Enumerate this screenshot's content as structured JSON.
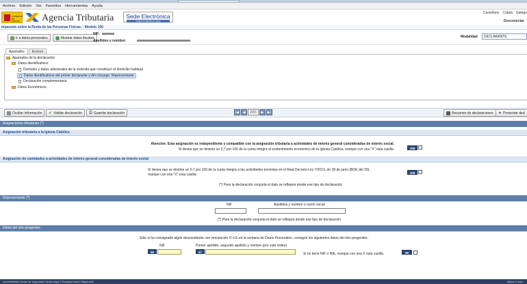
{
  "menu": [
    "Archivo",
    "Edición",
    "Ver",
    "Favoritos",
    "Herramientas",
    "Ayuda"
  ],
  "header": {
    "brand": "Agencia Tributaria",
    "sede_title": "Sede Electrónica",
    "sede_sub": "Todos los trámites en línea",
    "languages": [
      "Castellano",
      "Català",
      "Galego"
    ],
    "logout": "Desconectar",
    "spain_logo_text": "GOBIERNO DE ESPAÑA"
  },
  "model_title": "Impuesto sobre la Renta de las Personas Físicas. - Modelo 100",
  "personal": {
    "btn_personal": "Ir a datos personales",
    "btn_fiscal": "Mostrar datos fiscales",
    "nif_label": "NIF:",
    "name_label": "Apellidos y nombre:",
    "modalidad_label": "Modalidad",
    "modalidad_value": "DECLARANTE"
  },
  "tabs": [
    "Apartados",
    "Errores"
  ],
  "tree": [
    "Apartados de la declaración",
    "Datos identificativos",
    "Domicilio y datos adicionales de la vivienda que constituyó el domicilio habitual",
    "Datos identificativos del primer declarante y del cónyuge. Representante",
    "Declaración complementaria",
    "Datos Económicos"
  ],
  "toolbar": {
    "btn_hide": "Ocultar información",
    "btn_validate": "Validar declaración",
    "btn_save": "Guardar declaración",
    "page": "2/33",
    "btn_summary": "Resumen de declaraciones",
    "btn_present": "Presentar decl"
  },
  "asignaciones": {
    "title": "Asignaciones tributarias (*)",
    "sub1": "Asignación tributaria a la Iglesia Católica",
    "text1a": "Atención: Esta asignación es independiente y compatible con la asignación tributaria a actividades de interés general consideradas de interés social.",
    "text1b": "Si desea que se destine un 0,7 por 100 de la cuota íntegra al sostenimiento económico de la Iglesia Católica, marque con una \"X\" esta casilla:",
    "box1": "105",
    "sub2": "Asignación de cantidades a actividades de interés general consideradas de interés social",
    "text2a": "Si desea que se destine un 0,7 por 100 de la cuota íntegra a las actividades previstas en el Real Decreto-Ley 7/2013, de 28 de junio (BOE del 29),",
    "text2b": "marque con una \"X\" esta casilla:",
    "box2": "106",
    "note": "(*) Para la declaración conjunta el dato se reflejará desde ese tipo de declaración"
  },
  "representante": {
    "title": "Representante (*)",
    "nif": "NIF",
    "name": "Apellidos y nombre o razón social",
    "note": "(*) Para la declaración conjunta el dato se reflejará desde ese tipo de declaración"
  },
  "progenitor": {
    "title": "Datos del otro progenitor",
    "text": "Sólo si ha consignado algún descendiente con vinculación O ó E en la ventana de Datos Personales, consigne los siguientes datos del otro progenitor:",
    "nif_label": "NIF",
    "name_label": "Primer apellido, segundo apellido y nombre (por este orden)",
    "box_nif": "56",
    "box_name": "57",
    "no_nif": "Si no tiene NIF o NIE, marque con una X esta casilla",
    "box_no_nif": "58"
  },
  "footer": {
    "left": "Accesibilidad | Aviso de seguridad | Aviso legal | Transparencia | Mapa web",
    "right": "Mapa | Index"
  }
}
